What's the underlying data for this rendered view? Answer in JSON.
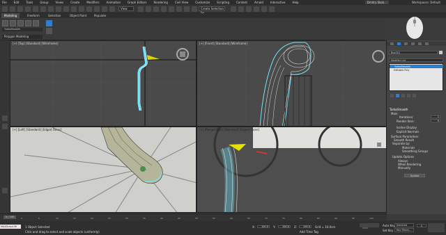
{
  "menu": [
    "File",
    "Edit",
    "Tools",
    "Group",
    "Views",
    "Create",
    "Modifiers",
    "Animation",
    "Graph Editors",
    "Rendering",
    "Civil View",
    "Customize",
    "Scripting",
    "Content",
    "Arnold",
    "Interactive",
    "Help"
  ],
  "user": "Dmitry Skok...",
  "workspace": "Workspaces: Default",
  "toolbar": {
    "view_dropdown": "View",
    "selection_set": "Create Selection Se"
  },
  "ribbon_tabs": [
    "Modeling",
    "Freeform",
    "Selection",
    "Object Paint",
    "Populate"
  ],
  "ribbon": {
    "panel": "Polygon Modeling",
    "item": "TurboSmooth"
  },
  "viewports": [
    {
      "label": "[+] [Top] [Standard] [Wireframe]"
    },
    {
      "label": "[+] [Front] [Standard] [Wireframe]"
    },
    {
      "label": "[+] [Left] [Standard] [Edged Faces]"
    },
    {
      "label": "[+] [Perspective] [Standard] [Edged Faces]"
    }
  ],
  "command_panel": {
    "object_name": "Box001",
    "modifier_list": "Modifier List",
    "stack": [
      "TurboSmooth",
      "Editable Poly"
    ],
    "rollout_title": "TurboSmooth",
    "main_label": "Main",
    "iterations_label": "Iterations:",
    "iterations": "1",
    "render_iters_label": "Render Iters:",
    "render_iters": "0",
    "isoline": "Isoline Display",
    "explicit": "Explicit Normals",
    "surface_params": "Surface Parameters",
    "smooth_result": "Smooth Result",
    "separate_by": "Separate by:",
    "materials": "Materials",
    "smoothing_groups": "Smoothing Groups",
    "update_options": "Update Options",
    "always": "Always",
    "when_rendering": "When Rendering",
    "manually": "Manually",
    "update_btn": "Update"
  },
  "timeline": {
    "frame": "0 / 100",
    "ticks": [
      "0",
      "5",
      "10",
      "15",
      "20",
      "25",
      "30",
      "35",
      "40",
      "45",
      "50",
      "55",
      "60",
      "65",
      "70",
      "75",
      "80",
      "85",
      "90",
      "95",
      "100"
    ]
  },
  "status": {
    "maxscript": "MAXScript Mi",
    "selected": "1 Object Selected",
    "prompt": "Click and drag to select and scale objects (uniformly)",
    "x_label": "X:",
    "x": "100.0",
    "y_label": "Y:",
    "y": "100.0",
    "z_label": "Z:",
    "z": "100.0",
    "grid": "Grid = 10.0cm",
    "add_time_tag": "Add Time Tag",
    "auto_key": "Auto Key",
    "set_key": "Set Key",
    "selected_dd": "Selected",
    "key_filters": "Key Filters...",
    "frame_field": "0"
  },
  "colors": {
    "accent": "#2d7fd3",
    "stack_highlight": "#c83a3a",
    "wire": "#6fe8ff"
  }
}
